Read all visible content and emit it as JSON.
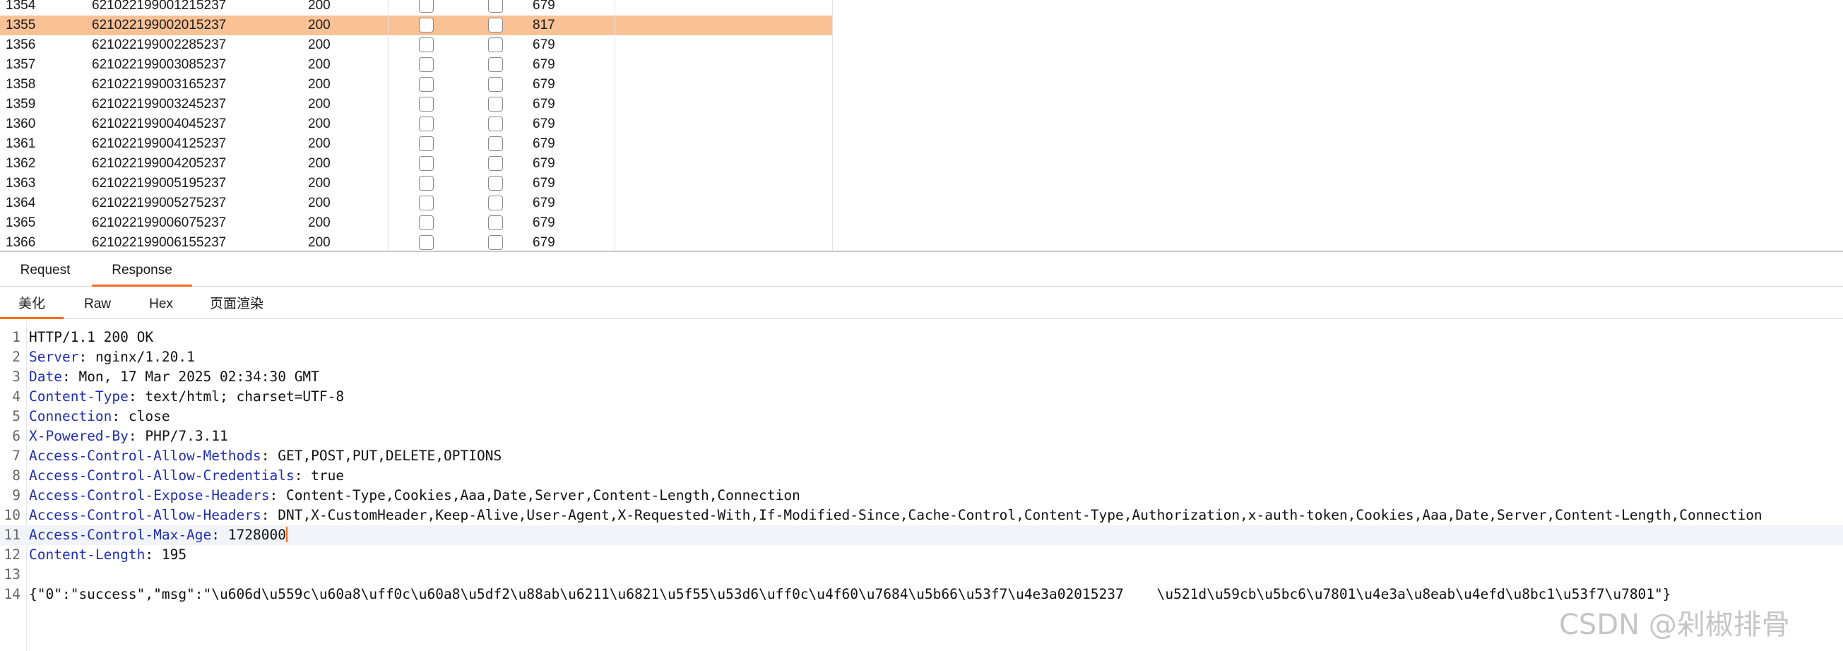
{
  "results_table": {
    "rows": [
      {
        "num": "1354",
        "payload": "621022199001215237",
        "status": "200",
        "length": "679",
        "selected": false
      },
      {
        "num": "1355",
        "payload": "621022199002015237",
        "status": "200",
        "length": "817",
        "selected": true
      },
      {
        "num": "1356",
        "payload": "621022199002285237",
        "status": "200",
        "length": "679",
        "selected": false
      },
      {
        "num": "1357",
        "payload": "621022199003085237",
        "status": "200",
        "length": "679",
        "selected": false
      },
      {
        "num": "1358",
        "payload": "621022199003165237",
        "status": "200",
        "length": "679",
        "selected": false
      },
      {
        "num": "1359",
        "payload": "621022199003245237",
        "status": "200",
        "length": "679",
        "selected": false
      },
      {
        "num": "1360",
        "payload": "621022199004045237",
        "status": "200",
        "length": "679",
        "selected": false
      },
      {
        "num": "1361",
        "payload": "621022199004125237",
        "status": "200",
        "length": "679",
        "selected": false
      },
      {
        "num": "1362",
        "payload": "621022199004205237",
        "status": "200",
        "length": "679",
        "selected": false
      },
      {
        "num": "1363",
        "payload": "621022199005195237",
        "status": "200",
        "length": "679",
        "selected": false
      },
      {
        "num": "1364",
        "payload": "621022199005275237",
        "status": "200",
        "length": "679",
        "selected": false
      },
      {
        "num": "1365",
        "payload": "621022199006075237",
        "status": "200",
        "length": "679",
        "selected": false
      },
      {
        "num": "1366",
        "payload": "621022199006155237",
        "status": "200",
        "length": "679",
        "selected": false
      }
    ]
  },
  "tabs": {
    "request": "Request",
    "response": "Response",
    "active": "Response"
  },
  "view_tabs": {
    "pretty": "美化",
    "raw": "Raw",
    "hex": "Hex",
    "render": "页面渲染",
    "active": "美化"
  },
  "editor": {
    "active_line": "11",
    "lines": [
      {
        "n": "1",
        "name": "",
        "value": "HTTP/1.1 200 OK"
      },
      {
        "n": "2",
        "name": "Server",
        "value": "nginx/1.20.1"
      },
      {
        "n": "3",
        "name": "Date",
        "value": "Mon, 17 Mar 2025 02:34:30 GMT"
      },
      {
        "n": "4",
        "name": "Content-Type",
        "value": "text/html; charset=UTF-8"
      },
      {
        "n": "5",
        "name": "Connection",
        "value": "close"
      },
      {
        "n": "6",
        "name": "X-Powered-By",
        "value": "PHP/7.3.11"
      },
      {
        "n": "7",
        "name": "Access-Control-Allow-Methods",
        "value": "GET,POST,PUT,DELETE,OPTIONS"
      },
      {
        "n": "8",
        "name": "Access-Control-Allow-Credentials",
        "value": "true"
      },
      {
        "n": "9",
        "name": "Access-Control-Expose-Headers",
        "value": "Content-Type,Cookies,Aaa,Date,Server,Content-Length,Connection"
      },
      {
        "n": "10",
        "name": "Access-Control-Allow-Headers",
        "value": "DNT,X-CustomHeader,Keep-Alive,User-Agent,X-Requested-With,If-Modified-Since,Cache-Control,Content-Type,Authorization,x-auth-token,Cookies,Aaa,Date,Server,Content-Length,Connection"
      },
      {
        "n": "11",
        "name": "Access-Control-Max-Age",
        "value": "1728000"
      },
      {
        "n": "12",
        "name": "Content-Length",
        "value": "195"
      },
      {
        "n": "13",
        "name": "",
        "value": ""
      },
      {
        "n": "14",
        "name": "",
        "value": "{\"0\":\"success\",\"msg\":\"\\u606d\\u559c\\u60a8\\uff0c\\u60a8\\u5df2\\u88ab\\u6211\\u6821\\u5f55\\u53d6\\uff0c\\u4f60\\u7684\\u5b66\\u53f7\\u4e3a02015237    \\u521d\\u59cb\\u5bc6\\u7801\\u4e3a\\u8eab\\u4efd\\u8bc1\\u53f7\\u7801\"}"
      }
    ]
  },
  "watermark": "CSDN @剁椒排骨",
  "colors": {
    "selected_row": "#fac195",
    "tab_accent": "#ff6a21",
    "header_name": "#1f2fb0"
  }
}
